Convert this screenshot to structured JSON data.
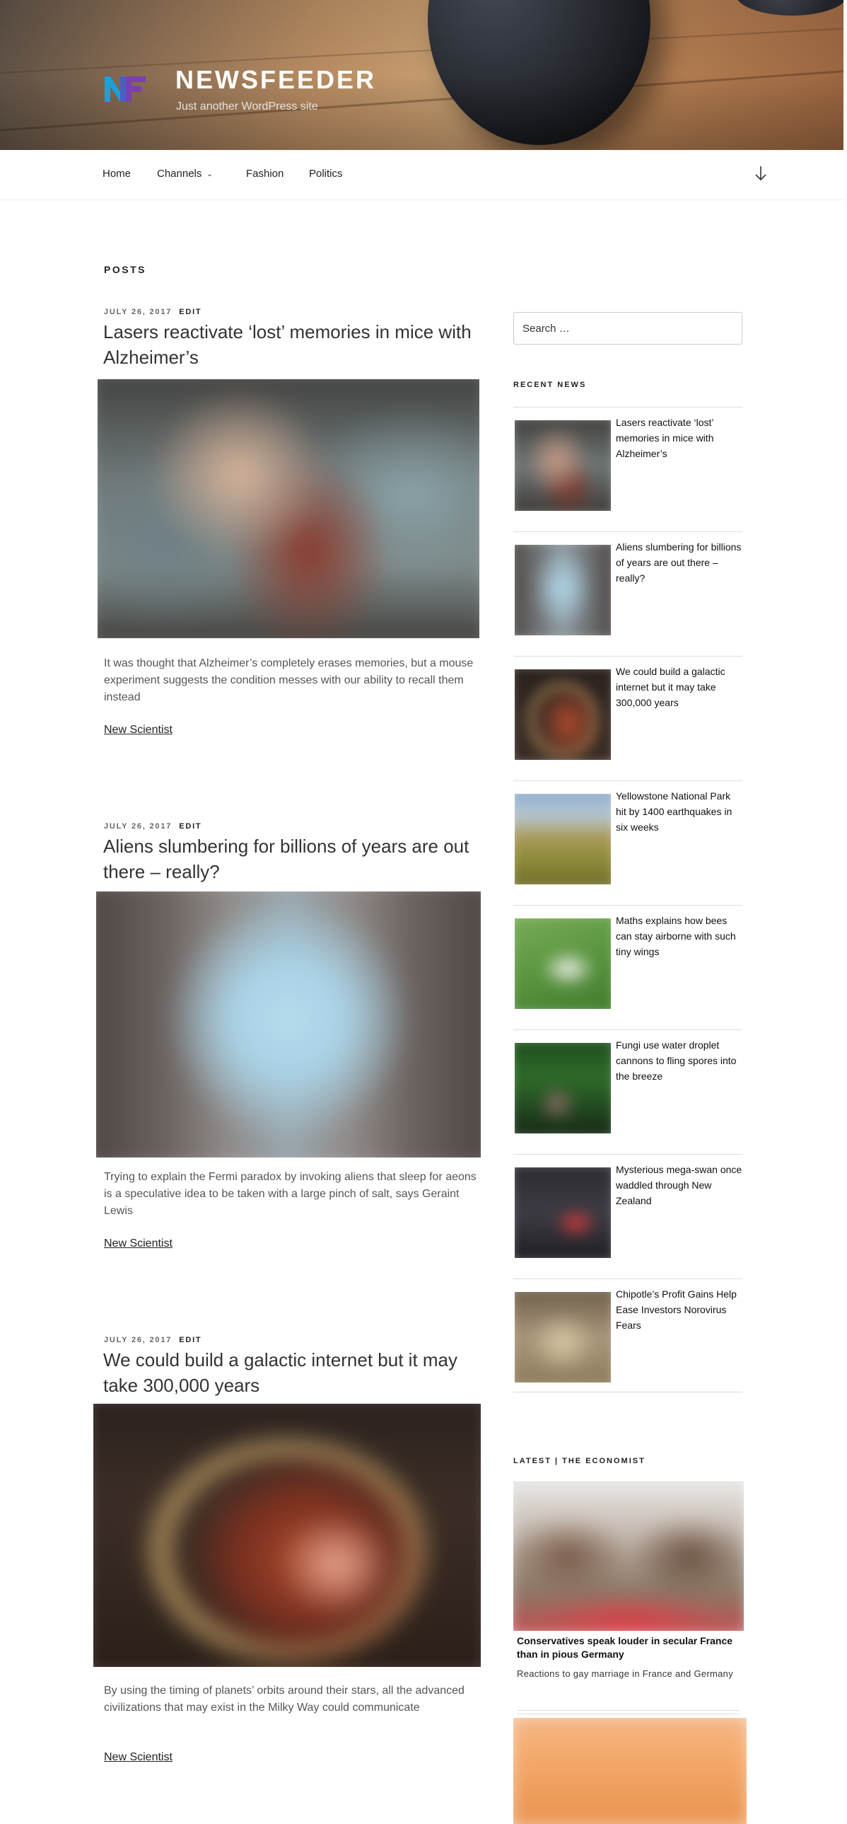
{
  "site": {
    "title": "NEWSFEEDER",
    "tagline": "Just another WordPress site"
  },
  "nav": {
    "items": [
      "Home",
      "Channels",
      "Fashion",
      "Politics"
    ],
    "channels_chevron": "chevron-down-icon",
    "scroll_icon": "arrow-down-icon"
  },
  "main": {
    "heading": "POSTS",
    "posts": [
      {
        "date": "JULY 26, 2017",
        "edit": "EDIT",
        "title": "Lasers reactivate ‘lost’ memories in mice with Alzheimer’s",
        "excerpt": "It was thought that Alzheimer’s completely erases memories, but a mouse experiment suggests the condition messes with our ability to recall them instead",
        "source": "New Scientist"
      },
      {
        "date": "JULY 26, 2017",
        "edit": "EDIT",
        "title": "Aliens slumbering for billions of years are out there – really?",
        "excerpt": "Trying to explain the Fermi paradox by invoking aliens that sleep for aeons is a speculative idea to be taken with a large pinch of salt, says Geraint Lewis",
        "source": "New Scientist"
      },
      {
        "date": "JULY 26, 2017",
        "edit": "EDIT",
        "title": "We could build a galactic internet but it may take 300,000 years",
        "excerpt": "By using the timing of planets’ orbits around their stars, all the advanced civilizations that may exist in the Milky Way could communicate",
        "source": "New Scientist"
      }
    ]
  },
  "sidebar": {
    "search_placeholder": "Search …",
    "recent_title": "RECENT NEWS",
    "recent": [
      "Lasers reactivate ‘lost’ memories in mice with Alzheimer’s",
      "Aliens slumbering for billions of years are out there – really?",
      "We could build a galactic internet but it may take 300,000 years",
      "Yellowstone National Park hit by 1400 earthquakes in six weeks",
      "Maths explains how bees can stay airborne with such tiny wings",
      "Fungi use water droplet cannons to fling spores into the breeze",
      "Mysterious mega-swan once waddled through New Zealand",
      "Chipotle’s Profit Gains Help Ease Investors Norovirus Fears"
    ],
    "economist_title": "LATEST | THE ECONOMIST",
    "economist": {
      "title": "Conservatives speak louder in secular France than in pious Germany",
      "desc": "Reactions to gay marriage in France and Germany"
    }
  }
}
